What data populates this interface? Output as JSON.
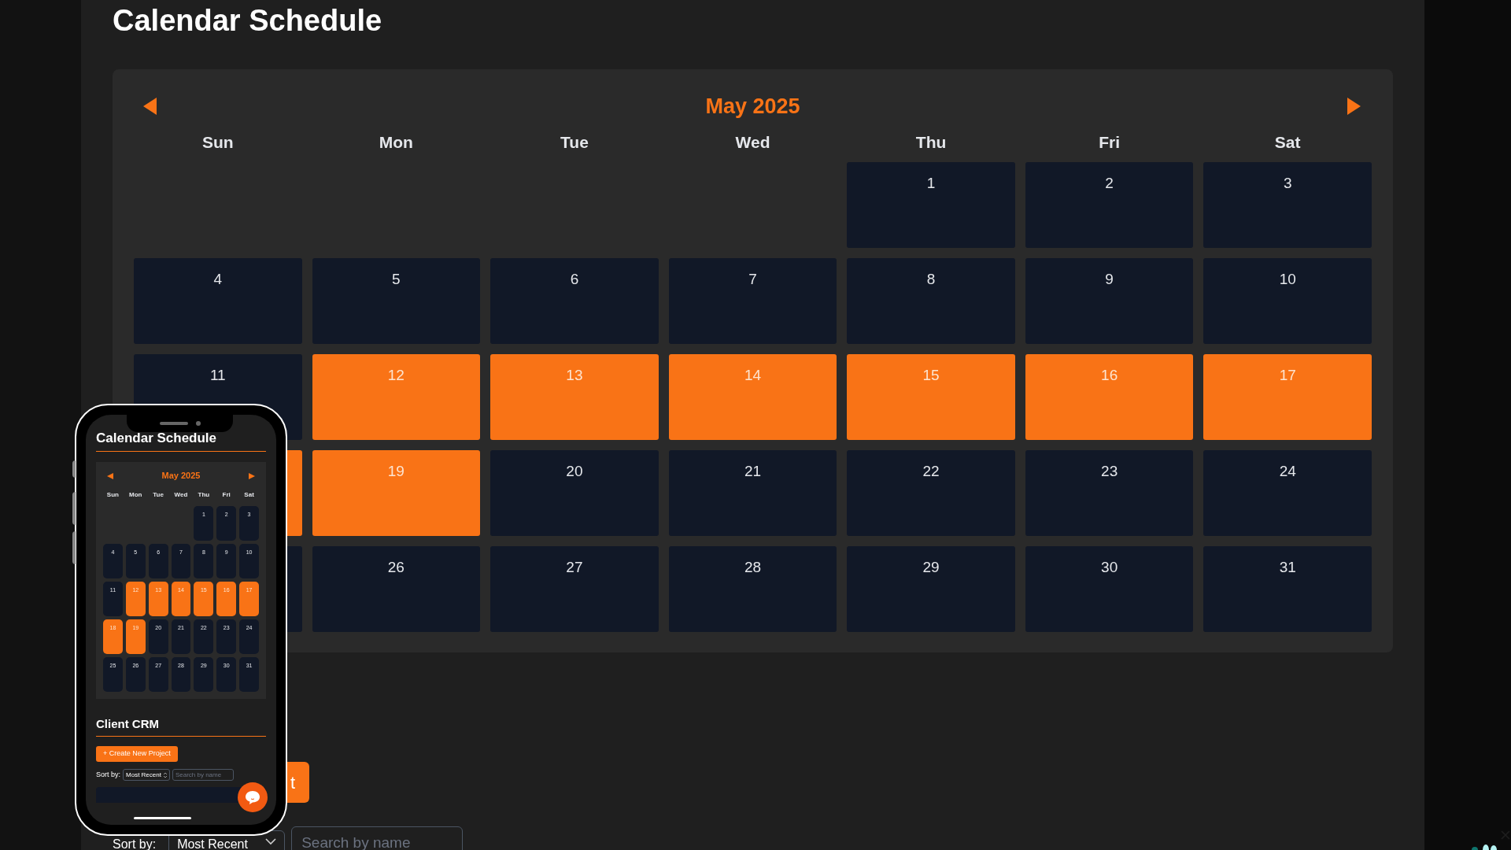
{
  "page": {
    "title": "Calendar Schedule"
  },
  "calendar": {
    "month": "May 2025",
    "weekdays": [
      "Sun",
      "Mon",
      "Tue",
      "Wed",
      "Thu",
      "Fri",
      "Sat"
    ],
    "weeks": [
      [
        {
          "kind": "blank"
        },
        {
          "kind": "blank"
        },
        {
          "kind": "blank"
        },
        {
          "kind": "blank"
        },
        {
          "kind": "day",
          "day": "1",
          "selected": false
        },
        {
          "kind": "day",
          "day": "2",
          "selected": false
        },
        {
          "kind": "day",
          "day": "3",
          "selected": false
        }
      ],
      [
        {
          "kind": "day",
          "day": "4",
          "selected": false
        },
        {
          "kind": "day",
          "day": "5",
          "selected": false
        },
        {
          "kind": "day",
          "day": "6",
          "selected": false
        },
        {
          "kind": "day",
          "day": "7",
          "selected": false
        },
        {
          "kind": "day",
          "day": "8",
          "selected": false
        },
        {
          "kind": "day",
          "day": "9",
          "selected": false
        },
        {
          "kind": "day",
          "day": "10",
          "selected": false
        }
      ],
      [
        {
          "kind": "day",
          "day": "11",
          "selected": false
        },
        {
          "kind": "day",
          "day": "12",
          "selected": true
        },
        {
          "kind": "day",
          "day": "13",
          "selected": true
        },
        {
          "kind": "day",
          "day": "14",
          "selected": true
        },
        {
          "kind": "day",
          "day": "15",
          "selected": true
        },
        {
          "kind": "day",
          "day": "16",
          "selected": true
        },
        {
          "kind": "day",
          "day": "17",
          "selected": true
        }
      ],
      [
        {
          "kind": "day",
          "selected": true
        },
        {
          "kind": "day",
          "day": "19",
          "selected": true
        },
        {
          "kind": "day",
          "day": "20",
          "selected": false
        },
        {
          "kind": "day",
          "day": "21",
          "selected": false
        },
        {
          "kind": "day",
          "day": "22",
          "selected": false
        },
        {
          "kind": "day",
          "day": "23",
          "selected": false
        },
        {
          "kind": "day",
          "day": "24",
          "selected": false
        }
      ],
      [
        {
          "kind": "day",
          "selected": false
        },
        {
          "kind": "day",
          "day": "26",
          "selected": false
        },
        {
          "kind": "day",
          "day": "27",
          "selected": false
        },
        {
          "kind": "day",
          "day": "28",
          "selected": false
        },
        {
          "kind": "day",
          "day": "29",
          "selected": false
        },
        {
          "kind": "day",
          "day": "30",
          "selected": false
        },
        {
          "kind": "day",
          "day": "31",
          "selected": false
        }
      ]
    ]
  },
  "crm": {
    "create_button": "t",
    "sort_label": "Sort by:",
    "sort_value": "Most Recent",
    "search_placeholder": "Search by name"
  },
  "phone": {
    "title": "Calendar Schedule",
    "calendar": {
      "month": "May 2025",
      "weekdays": [
        "Sun",
        "Mon",
        "Tue",
        "Wed",
        "Thu",
        "Fri",
        "Sat"
      ],
      "weeks": [
        [
          {
            "kind": "blank"
          },
          {
            "kind": "blank"
          },
          {
            "kind": "blank"
          },
          {
            "kind": "blank"
          },
          {
            "kind": "day",
            "day": "1",
            "selected": false
          },
          {
            "kind": "day",
            "day": "2",
            "selected": false
          },
          {
            "kind": "day",
            "day": "3",
            "selected": false
          }
        ],
        [
          {
            "kind": "day",
            "day": "4",
            "selected": false
          },
          {
            "kind": "day",
            "day": "5",
            "selected": false
          },
          {
            "kind": "day",
            "day": "6",
            "selected": false
          },
          {
            "kind": "day",
            "day": "7",
            "selected": false
          },
          {
            "kind": "day",
            "day": "8",
            "selected": false
          },
          {
            "kind": "day",
            "day": "9",
            "selected": false
          },
          {
            "kind": "day",
            "day": "10",
            "selected": false
          }
        ],
        [
          {
            "kind": "day",
            "day": "11",
            "selected": false
          },
          {
            "kind": "day",
            "day": "12",
            "selected": true
          },
          {
            "kind": "day",
            "day": "13",
            "selected": true
          },
          {
            "kind": "day",
            "day": "14",
            "selected": true
          },
          {
            "kind": "day",
            "day": "15",
            "selected": true
          },
          {
            "kind": "day",
            "day": "16",
            "selected": true
          },
          {
            "kind": "day",
            "day": "17",
            "selected": true
          }
        ],
        [
          {
            "kind": "day",
            "day": "18",
            "selected": true
          },
          {
            "kind": "day",
            "day": "19",
            "selected": true
          },
          {
            "kind": "day",
            "day": "20",
            "selected": false
          },
          {
            "kind": "day",
            "day": "21",
            "selected": false
          },
          {
            "kind": "day",
            "day": "22",
            "selected": false
          },
          {
            "kind": "day",
            "day": "23",
            "selected": false
          },
          {
            "kind": "day",
            "day": "24",
            "selected": false
          }
        ],
        [
          {
            "kind": "day",
            "day": "25",
            "selected": false
          },
          {
            "kind": "day",
            "day": "26",
            "selected": false
          },
          {
            "kind": "day",
            "day": "27",
            "selected": false
          },
          {
            "kind": "day",
            "day": "28",
            "selected": false
          },
          {
            "kind": "day",
            "day": "29",
            "selected": false
          },
          {
            "kind": "day",
            "day": "30",
            "selected": false
          },
          {
            "kind": "day",
            "day": "31",
            "selected": false
          }
        ]
      ]
    },
    "crm_title": "Client CRM",
    "create_button": "+ Create New Project",
    "sort_label": "Sort by:",
    "sort_value": "Most Recent",
    "search_placeholder": "Search by name"
  }
}
